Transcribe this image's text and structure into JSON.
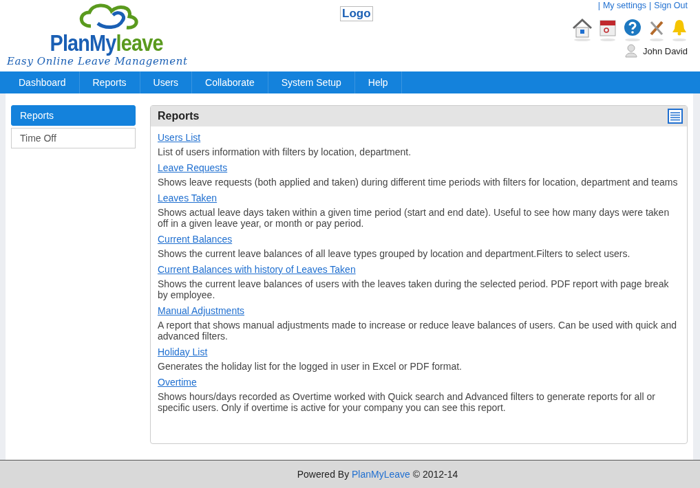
{
  "brand": {
    "name_primary": "PlanMy",
    "name_accent": "leave",
    "tagline": "Easy Online Leave Management"
  },
  "logo_placeholder": "Logo",
  "top_links": [
    {
      "separator": "|",
      "text": "My settings"
    },
    {
      "separator": "|",
      "text": "Sign Out"
    }
  ],
  "user": {
    "name": "John David"
  },
  "nav": [
    "Dashboard",
    "Reports",
    "Users",
    "Collaborate",
    "System Setup",
    "Help"
  ],
  "sidebar": {
    "items": [
      {
        "label": "Reports",
        "selected": true
      },
      {
        "label": "Time Off",
        "selected": false
      }
    ]
  },
  "panel": {
    "title": "Reports",
    "reports": [
      {
        "title": "Users List",
        "description": "List of users information with filters by location, department."
      },
      {
        "title": "Leave Requests",
        "description": "Shows leave requests (both applied and taken) during different time periods with filters for location, department and teams"
      },
      {
        "title": "Leaves Taken",
        "description": "Shows actual leave days taken within a given time period (start and end date). Useful to see how many days were taken off in a given leave year, or month or pay period."
      },
      {
        "title": "Current Balances",
        "description": "Shows the current leave balances of all leave types grouped by location and department.Filters to select users."
      },
      {
        "title": "Current Balances with history of Leaves Taken",
        "description": "Shows the current leave balances of users with the leaves taken during the selected period. PDF report with page break by employee."
      },
      {
        "title": "Manual Adjustments",
        "description": "A report that shows manual adjustments made to increase or reduce leave balances of users. Can be used with quick and advanced filters."
      },
      {
        "title": "Holiday List",
        "description": "Generates the holiday list for the logged in user in Excel or PDF format."
      },
      {
        "title": "Overtime",
        "description": "Shows hours/days recorded as Overtime worked with Quick search and Advanced filters to generate reports for all or specific users. Only if overtime is active for your company you can see this report."
      }
    ]
  },
  "footer": {
    "prefix": "Powered By",
    "link": "PlanMyLeave",
    "suffix": "© 2012-14"
  }
}
